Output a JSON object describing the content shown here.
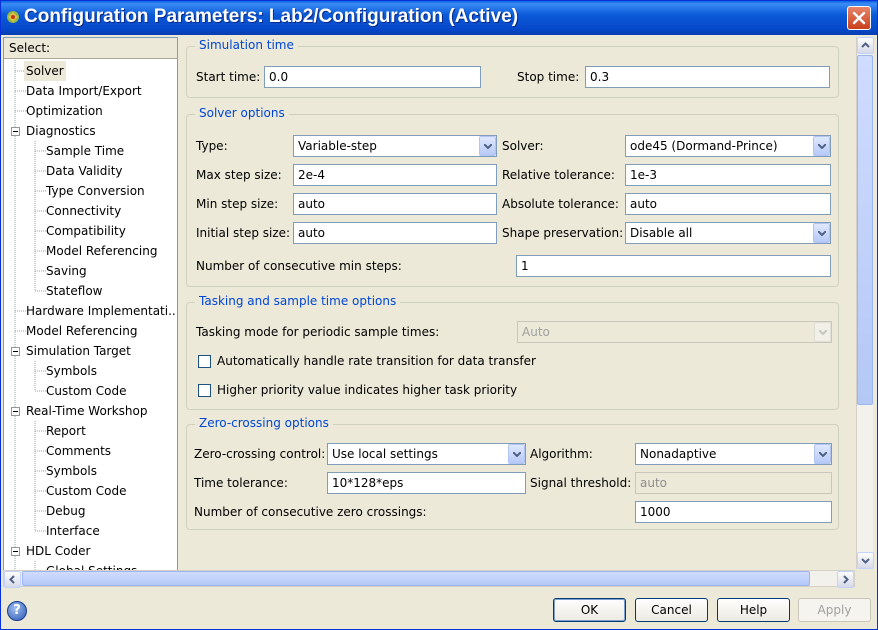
{
  "window": {
    "title": "Configuration Parameters: Lab2/Configuration (Active)"
  },
  "tree": {
    "header": "Select:",
    "items": [
      {
        "label": "Solver",
        "level": 1
      },
      {
        "label": "Data Import/Export",
        "level": 1
      },
      {
        "label": "Optimization",
        "level": 1
      },
      {
        "label": "Diagnostics",
        "level": 1
      },
      {
        "label": "Sample Time",
        "level": 2
      },
      {
        "label": "Data Validity",
        "level": 2
      },
      {
        "label": "Type Conversion",
        "level": 2
      },
      {
        "label": "Connectivity",
        "level": 2
      },
      {
        "label": "Compatibility",
        "level": 2
      },
      {
        "label": "Model Referencing",
        "level": 2
      },
      {
        "label": "Saving",
        "level": 2
      },
      {
        "label": "Stateflow",
        "level": 2
      },
      {
        "label": "Hardware Implementati...",
        "level": 1
      },
      {
        "label": "Model Referencing",
        "level": 1
      },
      {
        "label": "Simulation Target",
        "level": 1
      },
      {
        "label": "Symbols",
        "level": 2
      },
      {
        "label": "Custom Code",
        "level": 2
      },
      {
        "label": "Real-Time Workshop",
        "level": 1
      },
      {
        "label": "Report",
        "level": 2
      },
      {
        "label": "Comments",
        "level": 2
      },
      {
        "label": "Symbols",
        "level": 2
      },
      {
        "label": "Custom Code",
        "level": 2
      },
      {
        "label": "Debug",
        "level": 2
      },
      {
        "label": "Interface",
        "level": 2
      },
      {
        "label": "HDL Coder",
        "level": 1
      },
      {
        "label": "Global Settings",
        "level": 2
      }
    ]
  },
  "simulation_time": {
    "title": "Simulation time",
    "start_label": "Start time:",
    "start_value": "0.0",
    "stop_label": "Stop time:",
    "stop_value": "0.3"
  },
  "solver_options": {
    "title": "Solver options",
    "type_label": "Type:",
    "type_value": "Variable-step",
    "solver_label": "Solver:",
    "solver_value": "ode45 (Dormand-Prince)",
    "max_step_label": "Max step size:",
    "max_step_value": "2e-4",
    "rel_tol_label": "Relative tolerance:",
    "rel_tol_value": "1e-3",
    "min_step_label": "Min step size:",
    "min_step_value": "auto",
    "abs_tol_label": "Absolute tolerance:",
    "abs_tol_value": "auto",
    "init_step_label": "Initial step size:",
    "init_step_value": "auto",
    "shape_label": "Shape preservation:",
    "shape_value": "Disable all",
    "consec_min_label": "Number of consecutive min steps:",
    "consec_min_value": "1"
  },
  "tasking": {
    "title": "Tasking and sample time options",
    "mode_label": "Tasking mode for periodic sample times:",
    "mode_value": "Auto",
    "rate_transition_label": "Automatically handle rate transition for data transfer",
    "priority_label": "Higher priority value indicates higher task priority"
  },
  "zero_crossing": {
    "title": "Zero-crossing options",
    "control_label": "Zero-crossing control:",
    "control_value": "Use local settings",
    "algorithm_label": "Algorithm:",
    "algorithm_value": "Nonadaptive",
    "time_tol_label": "Time tolerance:",
    "time_tol_value": "10*128*eps",
    "signal_thresh_label": "Signal threshold:",
    "signal_thresh_value": "auto",
    "consec_zc_label": "Number of consecutive zero crossings:",
    "consec_zc_value": "1000"
  },
  "buttons": {
    "ok": "OK",
    "cancel": "Cancel",
    "help": "Help",
    "apply": "Apply"
  },
  "colors": {
    "accent": "#0046d5",
    "titlebar": "#0b5ad8"
  }
}
